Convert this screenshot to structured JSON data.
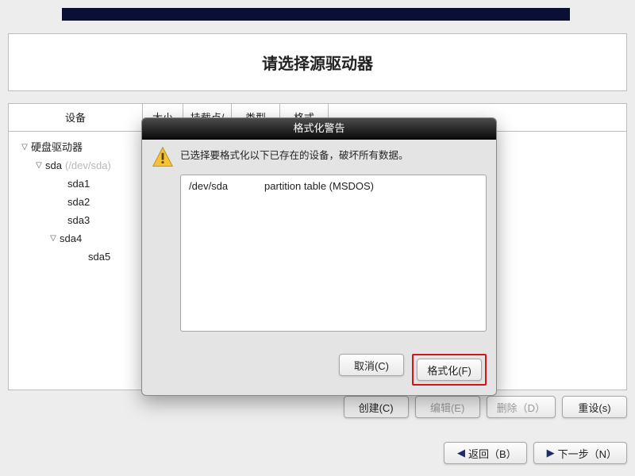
{
  "page": {
    "title": "请选择源驱动器"
  },
  "columns": {
    "device": "设备",
    "size": "大小",
    "mount": "挂载点/",
    "type": "类型",
    "format": "格式"
  },
  "tree": {
    "root_label": "硬盘驱动器",
    "disk": {
      "label": "sda",
      "annotation": "(/dev/sda)"
    },
    "parts": {
      "sda1": "sda1",
      "sda2": "sda2",
      "sda3": "sda3",
      "sda4": "sda4",
      "sda5": "sda5"
    }
  },
  "actions": {
    "create": "创建(C)",
    "edit": "编辑(E)",
    "delete": "删除（D）",
    "reset": "重设(s)"
  },
  "nav": {
    "back": "返回（B）",
    "next": "下一步（N）"
  },
  "modal": {
    "title": "格式化警告",
    "message": "已选择要格式化以下已存在的设备，破坏所有数据。",
    "dev_path": "/dev/sda",
    "dev_desc": "partition table (MSDOS)",
    "cancel": "取消(C)",
    "format": "格式化(F)"
  }
}
